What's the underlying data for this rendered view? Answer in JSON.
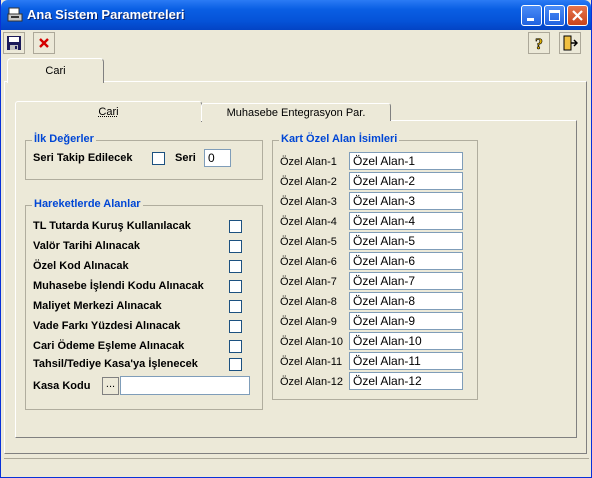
{
  "window": {
    "title": "Ana Sistem Parametreleri"
  },
  "toolbar": {
    "save_icon": "save-icon",
    "delete_icon": "delete-icon",
    "help_icon": "help-icon",
    "exit_icon": "exit-icon"
  },
  "outer_tabs": [
    {
      "label": "Cari"
    }
  ],
  "inner_tabs": [
    {
      "label": "Cari"
    },
    {
      "label": "Muhasebe Entegrasyon Par."
    }
  ],
  "ilk_degerler": {
    "title": "İlk Değerler",
    "seri_takip_label": "Seri Takip Edilecek",
    "seri_takip_checked": false,
    "seri_label": "Seri",
    "seri_value": "0"
  },
  "hareketler": {
    "title": "Hareketlerde Alanlar",
    "items": [
      {
        "label": "TL Tutarda Kuruş Kullanılacak",
        "checked": false
      },
      {
        "label": "Valör Tarihi Alınacak",
        "checked": false
      },
      {
        "label": "Özel Kod Alınacak",
        "checked": false
      },
      {
        "label": "Muhasebe İşlendi Kodu Alınacak",
        "checked": false
      },
      {
        "label": "Maliyet Merkezi Alınacak",
        "checked": false
      },
      {
        "label": "Vade Farkı Yüzdesi Alınacak",
        "checked": false
      },
      {
        "label": "Cari Ödeme Eşleme Alınacak",
        "checked": false
      },
      {
        "label": "Tahsil/Tediye Kasa'ya İşlenecek",
        "checked": false
      }
    ],
    "kasa_kodu_label": "Kasa Kodu",
    "kasa_kodu_browse": "...",
    "kasa_kodu_value": ""
  },
  "kart_ozel": {
    "title": "Kart Özel Alan İsimleri",
    "fields": [
      {
        "label": "Özel Alan-1",
        "value": "Özel Alan-1"
      },
      {
        "label": "Özel Alan-2",
        "value": "Özel Alan-2"
      },
      {
        "label": "Özel Alan-3",
        "value": "Özel Alan-3"
      },
      {
        "label": "Özel Alan-4",
        "value": "Özel Alan-4"
      },
      {
        "label": "Özel Alan-5",
        "value": "Özel Alan-5"
      },
      {
        "label": "Özel Alan-6",
        "value": "Özel Alan-6"
      },
      {
        "label": "Özel Alan-7",
        "value": "Özel Alan-7"
      },
      {
        "label": "Özel Alan-8",
        "value": "Özel Alan-8"
      },
      {
        "label": "Özel Alan-9",
        "value": "Özel Alan-9"
      },
      {
        "label": "Özel Alan-10",
        "value": "Özel Alan-10"
      },
      {
        "label": "Özel Alan-11",
        "value": "Özel Alan-11"
      },
      {
        "label": "Özel Alan-12",
        "value": "Özel Alan-12"
      }
    ]
  }
}
